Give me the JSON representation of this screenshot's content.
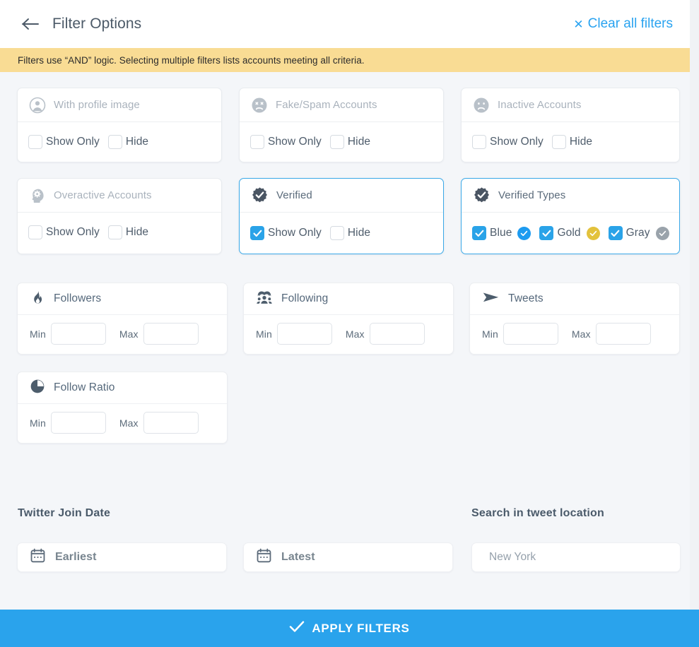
{
  "header": {
    "back_icon": "arrow-left-icon",
    "title": "Filter Options",
    "clear_all_label": "Clear all filters",
    "clear_all_icon": "close-x-icon"
  },
  "notice": {
    "text": "Filters use “AND” logic. Selecting multiple filters lists accounts meeting all criteria."
  },
  "toggle_filters": [
    {
      "id": "with-profile-image",
      "title": "With profile image",
      "icon": "user-circle-icon",
      "disabled": true,
      "active": false,
      "options": [
        {
          "label": "Show Only",
          "checked": false
        },
        {
          "label": "Hide",
          "checked": false
        }
      ]
    },
    {
      "id": "fake-spam-accounts",
      "title": "Fake/Spam Accounts",
      "icon": "dead-face-icon",
      "disabled": true,
      "active": false,
      "options": [
        {
          "label": "Show Only",
          "checked": false
        },
        {
          "label": "Hide",
          "checked": false
        }
      ]
    },
    {
      "id": "inactive-accounts",
      "title": "Inactive Accounts",
      "icon": "sad-face-icon",
      "disabled": true,
      "active": false,
      "options": [
        {
          "label": "Show Only",
          "checked": false
        },
        {
          "label": "Hide",
          "checked": false
        }
      ]
    },
    {
      "id": "overactive-accounts",
      "title": "Overactive Accounts",
      "icon": "head-gear-icon",
      "disabled": true,
      "active": false,
      "options": [
        {
          "label": "Show Only",
          "checked": false
        },
        {
          "label": "Hide",
          "checked": false
        }
      ]
    },
    {
      "id": "verified",
      "title": "Verified",
      "icon": "verified-badge-icon",
      "disabled": false,
      "active": true,
      "options": [
        {
          "label": "Show Only",
          "checked": true
        },
        {
          "label": "Hide",
          "checked": false
        }
      ]
    }
  ],
  "verified_types": {
    "id": "verified-types",
    "title": "Verified Types",
    "icon": "verified-badge-icon",
    "active": true,
    "types": [
      {
        "label": "Blue",
        "checked": true,
        "badge_icon": "verified-check-circle-icon",
        "color": "#1d9bf0"
      },
      {
        "label": "Gold",
        "checked": true,
        "badge_icon": "verified-check-circle-icon",
        "color": "#e3c23c"
      },
      {
        "label": "Gray",
        "checked": true,
        "badge_icon": "verified-check-circle-icon",
        "color": "#9aa3ab"
      }
    ]
  },
  "range_filters": [
    {
      "id": "followers",
      "title": "Followers",
      "icon": "flame-icon",
      "min_label": "Min",
      "max_label": "Max",
      "min_value": "",
      "max_value": ""
    },
    {
      "id": "following",
      "title": "Following",
      "icon": "people-group-icon",
      "min_label": "Min",
      "max_label": "Max",
      "min_value": "",
      "max_value": ""
    },
    {
      "id": "tweets",
      "title": "Tweets",
      "icon": "send-plane-icon",
      "min_label": "Min",
      "max_label": "Max",
      "min_value": "",
      "max_value": ""
    },
    {
      "id": "follow-ratio",
      "title": "Follow Ratio",
      "icon": "pie-chart-icon",
      "min_label": "Min",
      "max_label": "Max",
      "min_value": "",
      "max_value": ""
    }
  ],
  "join_date": {
    "section_label": "Twitter Join Date",
    "earliest_placeholder": "Earliest",
    "latest_placeholder": "Latest",
    "earliest_value": "",
    "latest_value": "",
    "calendar_icon": "calendar-icon"
  },
  "location": {
    "section_label": "Search in tweet location",
    "placeholder": "New York",
    "value": ""
  },
  "apply": {
    "label": "APPLY FILTERS",
    "icon": "check-icon"
  },
  "colors": {
    "accent": "#2aa3ec",
    "notice_bg": "#f9dc94",
    "page_bg": "#f4f6f9",
    "card_bg": "#ffffff",
    "active_border": "#3aa9e8",
    "title_text": "#4c5a68",
    "dim_text": "#a9b2bc"
  }
}
